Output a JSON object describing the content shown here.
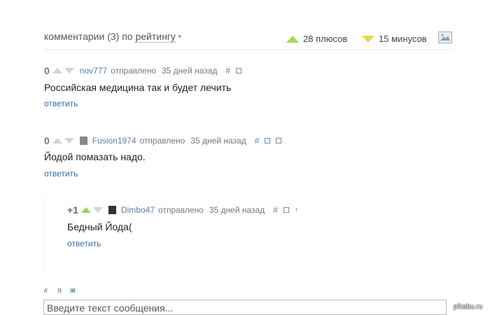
{
  "header": {
    "comments_label": "комментарии (3) по",
    "sort_label": "рейтингу",
    "pluses": "28 плюсов",
    "minuses": "15 минусов"
  },
  "comments": [
    {
      "score": "0",
      "user": "nov777",
      "posted": "отправлено",
      "date": "35 дней назад",
      "hash": "#",
      "text": "Российская медицина так и будет лечить",
      "reply": "ответить"
    },
    {
      "score": "0",
      "user": "Fusion1974",
      "posted": "отправлено",
      "date": "35 дней назад",
      "hash": "#",
      "text": "Йодой помазать надо.",
      "reply": "ответить"
    },
    {
      "score": "+1",
      "user": "Dimbo47",
      "posted": "отправлено",
      "date": "35 дней назад",
      "hash": "#",
      "text": "Бедный Йода(",
      "reply": "ответить"
    }
  ],
  "editor": {
    "italic": "к",
    "quote": "я",
    "bold": "ж",
    "placeholder": "Введите текст сообщения..."
  },
  "watermark": "pikabu.ru",
  "colors": {
    "link": "#5a7fa8",
    "reply": "#2d6fb0",
    "plus": "#a8d65a",
    "minus": "#f3d24f"
  }
}
